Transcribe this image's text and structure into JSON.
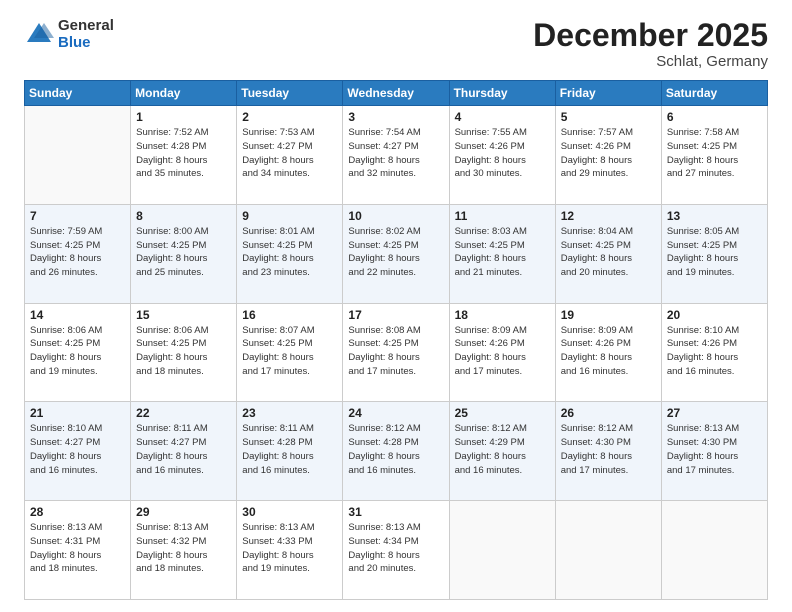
{
  "header": {
    "logo_general": "General",
    "logo_blue": "Blue",
    "month_title": "December 2025",
    "location": "Schlat, Germany"
  },
  "days_of_week": [
    "Sunday",
    "Monday",
    "Tuesday",
    "Wednesday",
    "Thursday",
    "Friday",
    "Saturday"
  ],
  "weeks": [
    [
      {
        "day": "",
        "info": ""
      },
      {
        "day": "1",
        "info": "Sunrise: 7:52 AM\nSunset: 4:28 PM\nDaylight: 8 hours\nand 35 minutes."
      },
      {
        "day": "2",
        "info": "Sunrise: 7:53 AM\nSunset: 4:27 PM\nDaylight: 8 hours\nand 34 minutes."
      },
      {
        "day": "3",
        "info": "Sunrise: 7:54 AM\nSunset: 4:27 PM\nDaylight: 8 hours\nand 32 minutes."
      },
      {
        "day": "4",
        "info": "Sunrise: 7:55 AM\nSunset: 4:26 PM\nDaylight: 8 hours\nand 30 minutes."
      },
      {
        "day": "5",
        "info": "Sunrise: 7:57 AM\nSunset: 4:26 PM\nDaylight: 8 hours\nand 29 minutes."
      },
      {
        "day": "6",
        "info": "Sunrise: 7:58 AM\nSunset: 4:25 PM\nDaylight: 8 hours\nand 27 minutes."
      }
    ],
    [
      {
        "day": "7",
        "info": "Sunrise: 7:59 AM\nSunset: 4:25 PM\nDaylight: 8 hours\nand 26 minutes."
      },
      {
        "day": "8",
        "info": "Sunrise: 8:00 AM\nSunset: 4:25 PM\nDaylight: 8 hours\nand 25 minutes."
      },
      {
        "day": "9",
        "info": "Sunrise: 8:01 AM\nSunset: 4:25 PM\nDaylight: 8 hours\nand 23 minutes."
      },
      {
        "day": "10",
        "info": "Sunrise: 8:02 AM\nSunset: 4:25 PM\nDaylight: 8 hours\nand 22 minutes."
      },
      {
        "day": "11",
        "info": "Sunrise: 8:03 AM\nSunset: 4:25 PM\nDaylight: 8 hours\nand 21 minutes."
      },
      {
        "day": "12",
        "info": "Sunrise: 8:04 AM\nSunset: 4:25 PM\nDaylight: 8 hours\nand 20 minutes."
      },
      {
        "day": "13",
        "info": "Sunrise: 8:05 AM\nSunset: 4:25 PM\nDaylight: 8 hours\nand 19 minutes."
      }
    ],
    [
      {
        "day": "14",
        "info": "Sunrise: 8:06 AM\nSunset: 4:25 PM\nDaylight: 8 hours\nand 19 minutes."
      },
      {
        "day": "15",
        "info": "Sunrise: 8:06 AM\nSunset: 4:25 PM\nDaylight: 8 hours\nand 18 minutes."
      },
      {
        "day": "16",
        "info": "Sunrise: 8:07 AM\nSunset: 4:25 PM\nDaylight: 8 hours\nand 17 minutes."
      },
      {
        "day": "17",
        "info": "Sunrise: 8:08 AM\nSunset: 4:25 PM\nDaylight: 8 hours\nand 17 minutes."
      },
      {
        "day": "18",
        "info": "Sunrise: 8:09 AM\nSunset: 4:26 PM\nDaylight: 8 hours\nand 17 minutes."
      },
      {
        "day": "19",
        "info": "Sunrise: 8:09 AM\nSunset: 4:26 PM\nDaylight: 8 hours\nand 16 minutes."
      },
      {
        "day": "20",
        "info": "Sunrise: 8:10 AM\nSunset: 4:26 PM\nDaylight: 8 hours\nand 16 minutes."
      }
    ],
    [
      {
        "day": "21",
        "info": "Sunrise: 8:10 AM\nSunset: 4:27 PM\nDaylight: 8 hours\nand 16 minutes."
      },
      {
        "day": "22",
        "info": "Sunrise: 8:11 AM\nSunset: 4:27 PM\nDaylight: 8 hours\nand 16 minutes."
      },
      {
        "day": "23",
        "info": "Sunrise: 8:11 AM\nSunset: 4:28 PM\nDaylight: 8 hours\nand 16 minutes."
      },
      {
        "day": "24",
        "info": "Sunrise: 8:12 AM\nSunset: 4:28 PM\nDaylight: 8 hours\nand 16 minutes."
      },
      {
        "day": "25",
        "info": "Sunrise: 8:12 AM\nSunset: 4:29 PM\nDaylight: 8 hours\nand 16 minutes."
      },
      {
        "day": "26",
        "info": "Sunrise: 8:12 AM\nSunset: 4:30 PM\nDaylight: 8 hours\nand 17 minutes."
      },
      {
        "day": "27",
        "info": "Sunrise: 8:13 AM\nSunset: 4:30 PM\nDaylight: 8 hours\nand 17 minutes."
      }
    ],
    [
      {
        "day": "28",
        "info": "Sunrise: 8:13 AM\nSunset: 4:31 PM\nDaylight: 8 hours\nand 18 minutes."
      },
      {
        "day": "29",
        "info": "Sunrise: 8:13 AM\nSunset: 4:32 PM\nDaylight: 8 hours\nand 18 minutes."
      },
      {
        "day": "30",
        "info": "Sunrise: 8:13 AM\nSunset: 4:33 PM\nDaylight: 8 hours\nand 19 minutes."
      },
      {
        "day": "31",
        "info": "Sunrise: 8:13 AM\nSunset: 4:34 PM\nDaylight: 8 hours\nand 20 minutes."
      },
      {
        "day": "",
        "info": ""
      },
      {
        "day": "",
        "info": ""
      },
      {
        "day": "",
        "info": ""
      }
    ]
  ]
}
